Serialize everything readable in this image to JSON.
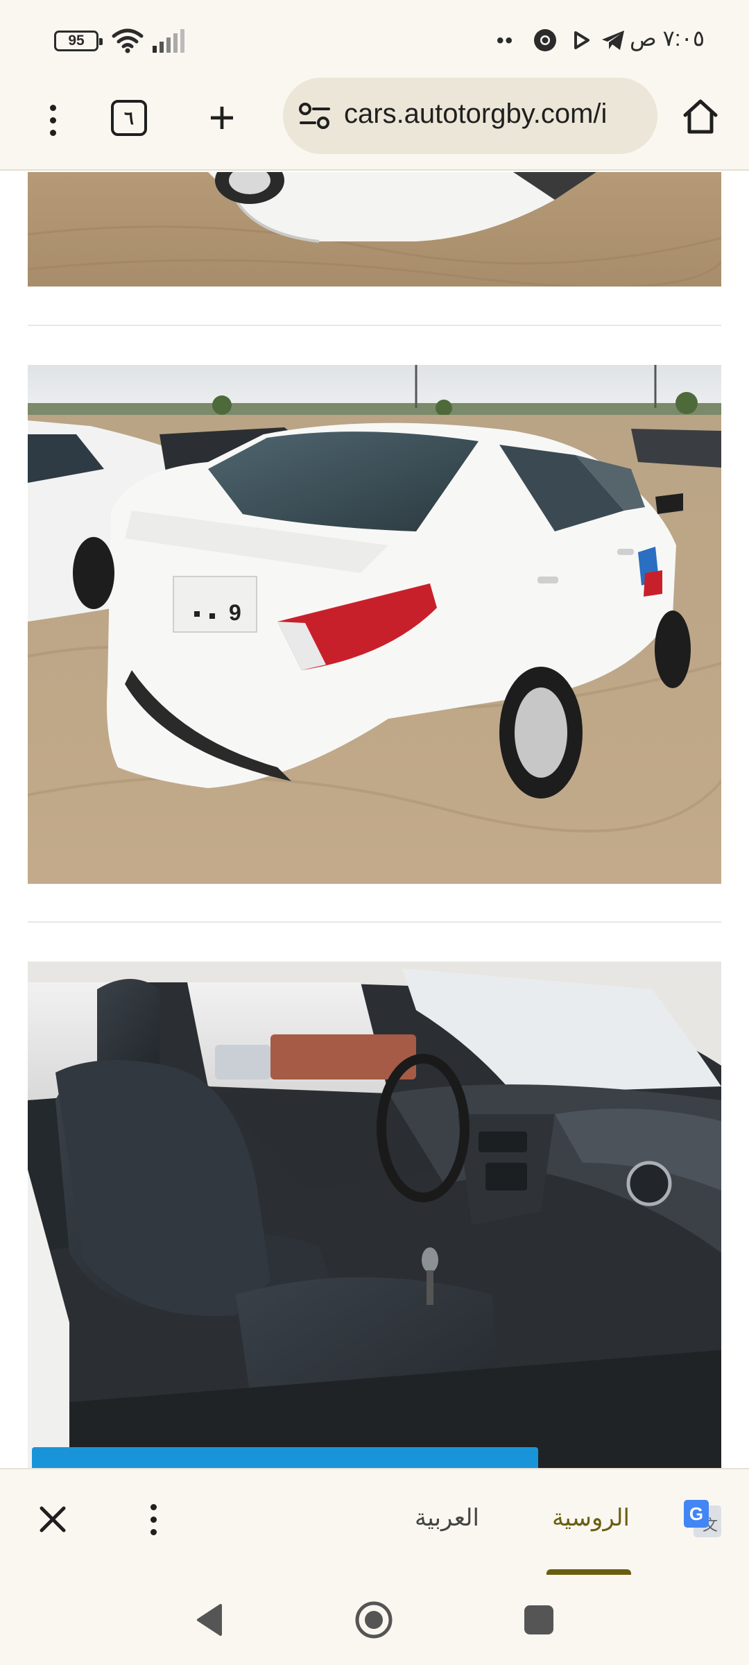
{
  "status_bar": {
    "battery": "95",
    "overflow_dots": "••",
    "time": "٧:٠٥ ص"
  },
  "browser": {
    "tab_count": "٦",
    "new_tab_label": "+",
    "url": "cars.autotorgby.com/i"
  },
  "content": {
    "photos": [
      {
        "alt": "car-front-bumper-photo"
      },
      {
        "alt": "car-rear-photo",
        "plate": "9"
      },
      {
        "alt": "car-interior-photo"
      }
    ],
    "accent_color": "#1a94d8"
  },
  "translate_bar": {
    "languages": [
      {
        "label": "العربية",
        "selected": false
      },
      {
        "label": "الروسية",
        "selected": true
      }
    ],
    "selected_color": "#6a5e10"
  },
  "icons": {
    "status": [
      "battery-icon",
      "wifi-icon",
      "signal-icon",
      "chrome-icon",
      "play-icon",
      "telegram-icon"
    ],
    "toolbar": [
      "menu-icon",
      "tabs-icon",
      "plus-icon",
      "site-settings-icon",
      "home-icon"
    ],
    "translate": [
      "close-icon",
      "menu-icon",
      "google-translate-icon"
    ],
    "nav": [
      "back-icon",
      "home-icon",
      "recents-icon"
    ]
  }
}
